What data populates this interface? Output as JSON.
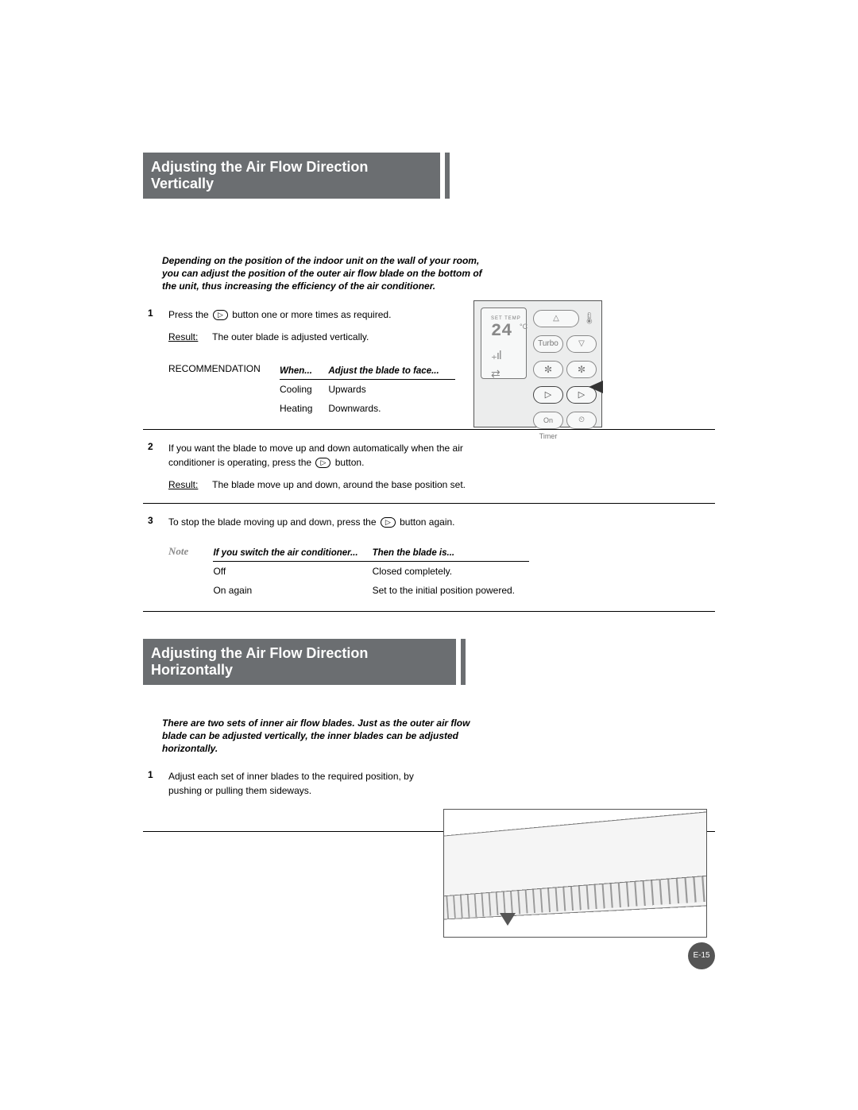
{
  "section1": {
    "heading": "Adjusting the Air Flow Direction Vertically",
    "intro": "Depending on the position of the indoor unit on the wall of your room, you can adjust the position of the outer air ﬂow blade on the bottom of the unit, thus increasing the efﬁciency of the air conditioner.",
    "step1_num": "1",
    "step1_a": "Press the ",
    "step1_b": " button one or more times as required.",
    "result_label": "Result:",
    "step1_result": "The outer blade is adjusted vertically.",
    "rec_label": "RECOMMENDATION",
    "rec_head_when": "When...",
    "rec_head_adjust": "Adjust the blade to face...",
    "rec_r1_c1": "Cooling",
    "rec_r1_c2": "Upwards",
    "rec_r2_c1": "Heating",
    "rec_r2_c2": "Downwards.",
    "step2_num": "2",
    "step2_a": "If you want the blade to move up and down automatically when the air conditioner is operating, press the ",
    "step2_b": " button.",
    "step2_result": "The blade move up and down, around the base position set.",
    "step3_num": "3",
    "step3_a": "To stop the blade moving up and down, press the ",
    "step3_b": " button again.",
    "note_label": "Note",
    "note_head_if": "If you switch the air conditioner...",
    "note_head_then": "Then the blade is...",
    "note_r1_c1": "Off",
    "note_r1_c2": "Closed completely.",
    "note_r2_c1": "On again",
    "note_r2_c2": "Set to the initial position powered."
  },
  "remote": {
    "settemp": "SET TEMP",
    "temp": "24",
    "unit": "°C",
    "turbo": "Turbo",
    "ontimer": "On Timer",
    "swing_glyph": "⇄",
    "swing_icon": "▷"
  },
  "section2": {
    "heading": "Adjusting the Air Flow Direction Horizontally",
    "intro": "There are two sets of inner air flow blades. Just as the outer air flow blade can be adjusted vertically, the inner blades can be adjusted horizontally.",
    "step1_num": "1",
    "step1": "Adjust each set of inner blades to the required position, by pushing or pulling them sideways."
  },
  "button_icon": "▷",
  "page_num": "E-15"
}
